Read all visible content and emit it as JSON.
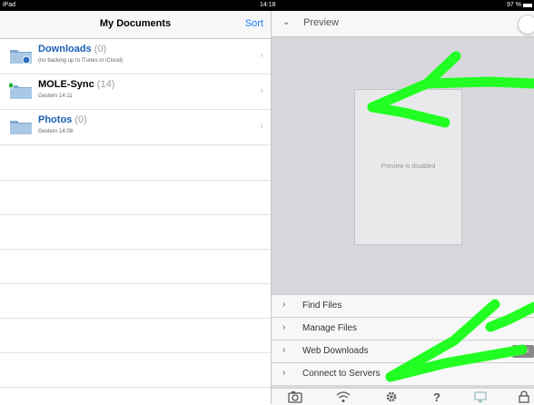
{
  "status_bar": {
    "device": "iPad",
    "time": "14:18",
    "battery": "97 %"
  },
  "left_panel": {
    "title": "My Documents",
    "sort_label": "Sort",
    "documents": [
      {
        "name": "Downloads",
        "count": "(0)",
        "subtitle": "(no backing up to iTunes or iCloud)",
        "icon": "folder-download-icon"
      },
      {
        "name": "MOLE-Sync",
        "count": "(14)",
        "subtitle": "Gestern 14:11",
        "icon": "folder-sync-icon"
      },
      {
        "name": "Photos",
        "count": "(0)",
        "subtitle": "Gestern 14:08",
        "icon": "folder-icon"
      }
    ]
  },
  "right_panel": {
    "preview_label": "Preview",
    "preview_message": "Preview is disabled",
    "menu": [
      {
        "label": "Find Files"
      },
      {
        "label": "Manage Files"
      },
      {
        "label": "Web Downloads",
        "action": "Sync"
      },
      {
        "label": "Connect to Servers"
      }
    ],
    "toolbar_icons": [
      "camera-icon",
      "wifi-icon",
      "gear-icon",
      "help-icon",
      "display-icon",
      "lock-icon"
    ],
    "toolbar_help_glyph": "?"
  },
  "colors": {
    "accent": "#1a7cf5",
    "annotation": "#22ff22"
  }
}
